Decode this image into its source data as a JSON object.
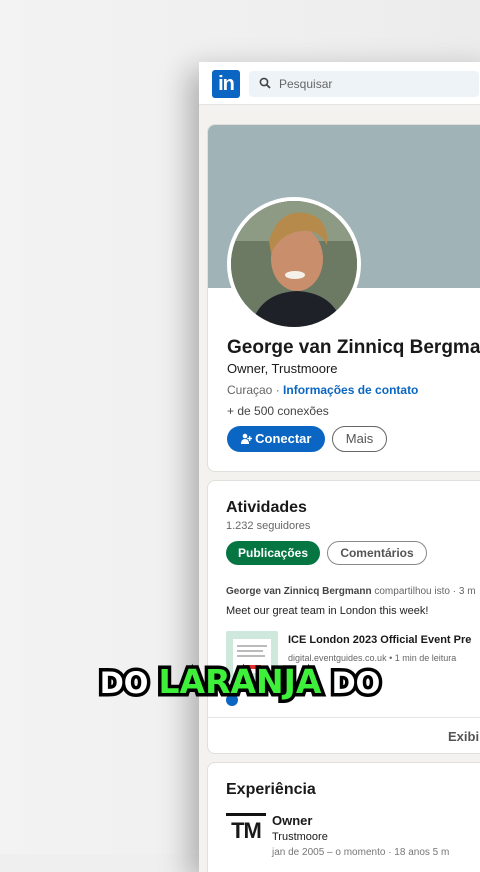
{
  "topbar": {
    "logo_text": "in",
    "search_placeholder": "Pesquisar"
  },
  "profile": {
    "name": "George van Zinnicq Bergmann",
    "headline": "Owner, Trustmoore",
    "location": "Curaçao",
    "separator": " · ",
    "contact_link": "Informações de contato",
    "connections": "+ de 500 conexões",
    "connect_label": "Conectar",
    "more_label": "Mais"
  },
  "activity": {
    "title": "Atividades",
    "followers": "1.232 seguidores",
    "tab_posts": "Publicações",
    "tab_comments": "Comentários",
    "post_author": "George van Zinnicq Bergmann",
    "post_action": " compartilhou isto · 3 m",
    "post_text": "Meet our great team in London this week!",
    "link_title": "ICE London 2023 Official Event Pre",
    "link_source": "digital.eventguides.co.uk • 1 min de leitura",
    "show_all": "Exibir"
  },
  "experience": {
    "title": "Experiência",
    "logo_text": "TM",
    "role": "Owner",
    "company": "Trustmoore",
    "dates": "jan de 2005 – o momento · 18 anos 5 m"
  },
  "caption": {
    "word1": "DO ",
    "word2": "LARANJA",
    "word3": " DO"
  },
  "colors": {
    "linkedin_blue": "#0a66c2",
    "active_tab_green": "#057642",
    "caption_green": "#3ef03a"
  }
}
